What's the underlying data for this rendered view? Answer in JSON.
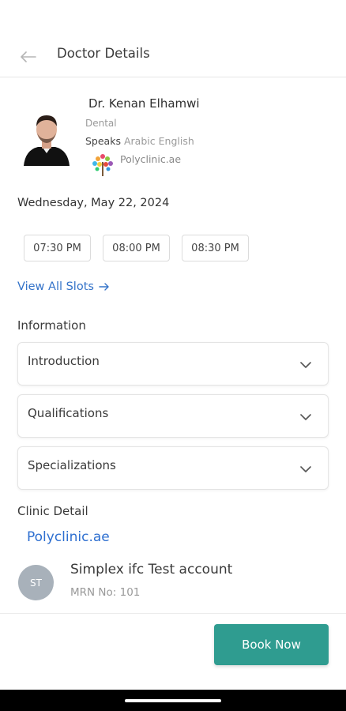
{
  "header": {
    "title": "Doctor Details"
  },
  "doctor": {
    "name": "Dr. Kenan Elhamwi",
    "department": "Dental",
    "speaks_label": "Speaks",
    "languages": [
      "Arabic",
      "English"
    ],
    "clinic": "Polyclinic.ae"
  },
  "schedule": {
    "date": "Wednesday, May 22, 2024",
    "slots": [
      "07:30 PM",
      "08:00 PM",
      "08:30 PM"
    ],
    "view_all_label": "View All Slots"
  },
  "information": {
    "label": "Information",
    "sections": [
      "Introduction",
      "Qualifications",
      "Specializations"
    ]
  },
  "clinic_detail": {
    "label": "Clinic Detail",
    "name": "Polyclinic.ae"
  },
  "patient": {
    "initials": "ST",
    "name": "Simplex ifc Test account",
    "mrn": "MRN No: 101"
  },
  "footer": {
    "book_label": "Book Now"
  },
  "colors": {
    "accent": "#2f9c90",
    "link": "#2e6fd0"
  }
}
